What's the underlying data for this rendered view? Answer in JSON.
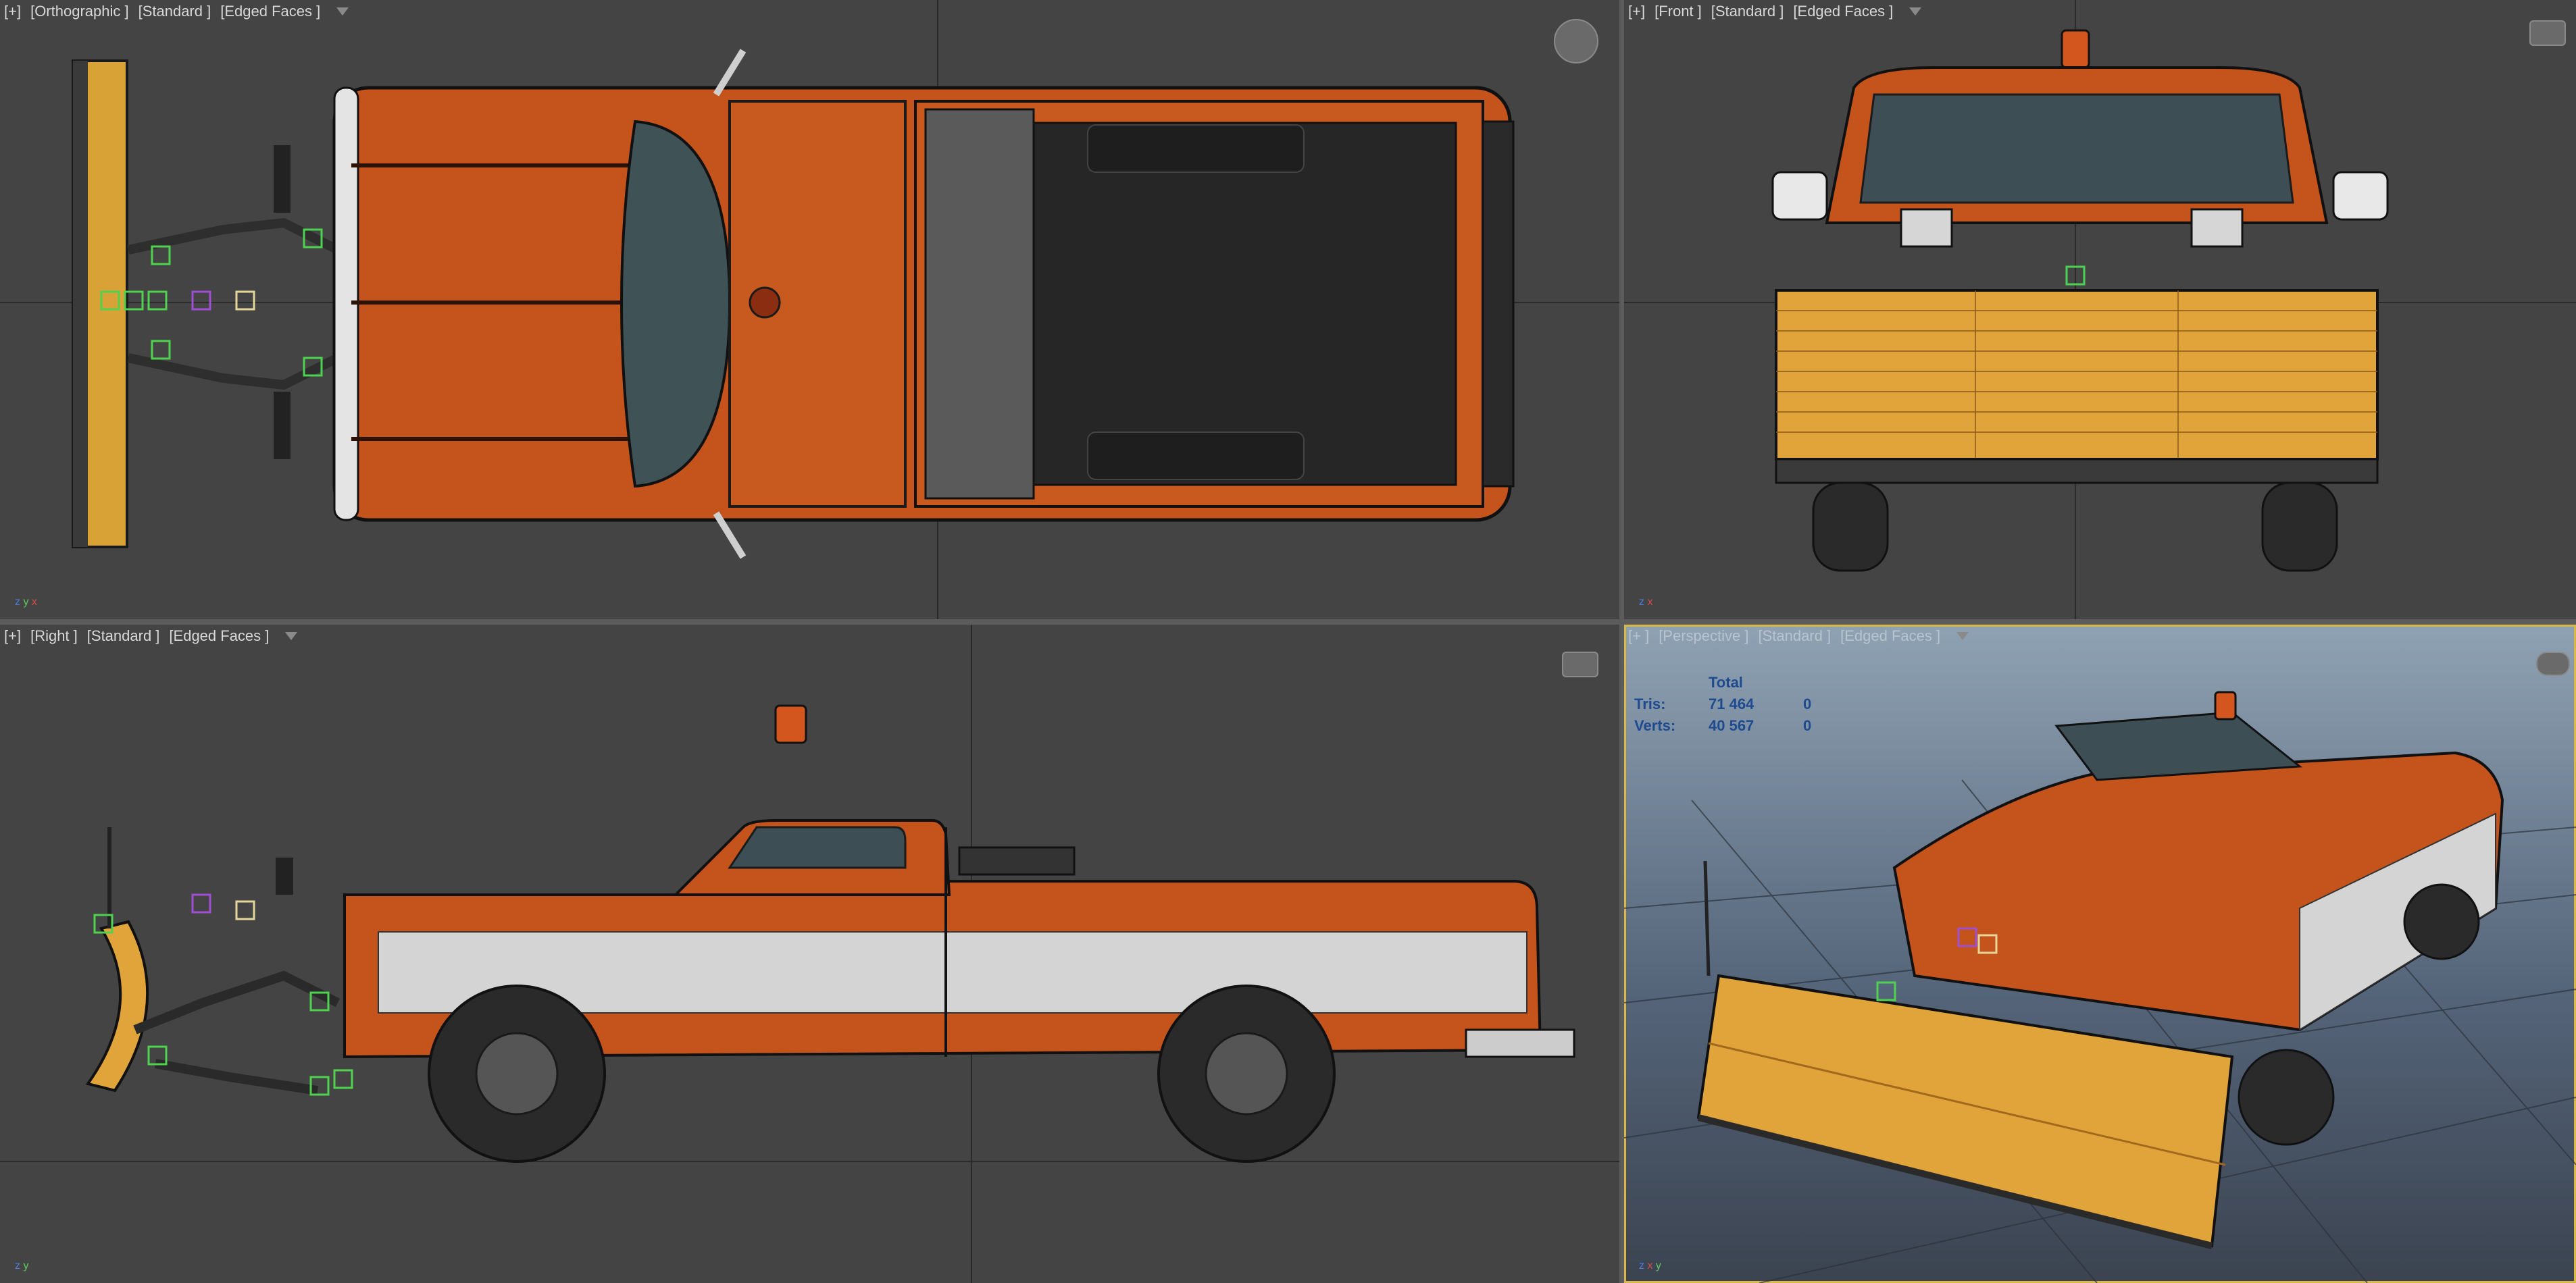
{
  "viewports": {
    "top": {
      "tags": [
        "[+]",
        "[Orthographic ]",
        "[Standard ]",
        "[Edged Faces ]"
      ]
    },
    "front": {
      "tags": [
        "[+]",
        "[Front ]",
        "[Standard ]",
        "[Edged Faces ]"
      ]
    },
    "right": {
      "tags": [
        "[+]",
        "[Right ]",
        "[Standard ]",
        "[Edged Faces ]"
      ]
    },
    "persp": {
      "tags": [
        "[+ ]",
        "[Perspective ]",
        "[Standard ]",
        "[Edged Faces ]"
      ]
    }
  },
  "stats": {
    "header": "Total",
    "tris_label": "Tris:",
    "tris_total": "71 464",
    "tris_selected": "0",
    "verts_label": "Verts:",
    "verts_total": "40 567",
    "verts_selected": "0"
  },
  "axes": {
    "x": "x",
    "y": "y",
    "z": "z"
  },
  "colors": {
    "viewport_bg": "#444444",
    "truck_orange": "#c4531c",
    "plow_yellow": "#e0a43a",
    "active_border": "#d9b84a"
  },
  "icons": [
    "filter-icon",
    "viewcube-icon",
    "axis-tripod-icon"
  ]
}
